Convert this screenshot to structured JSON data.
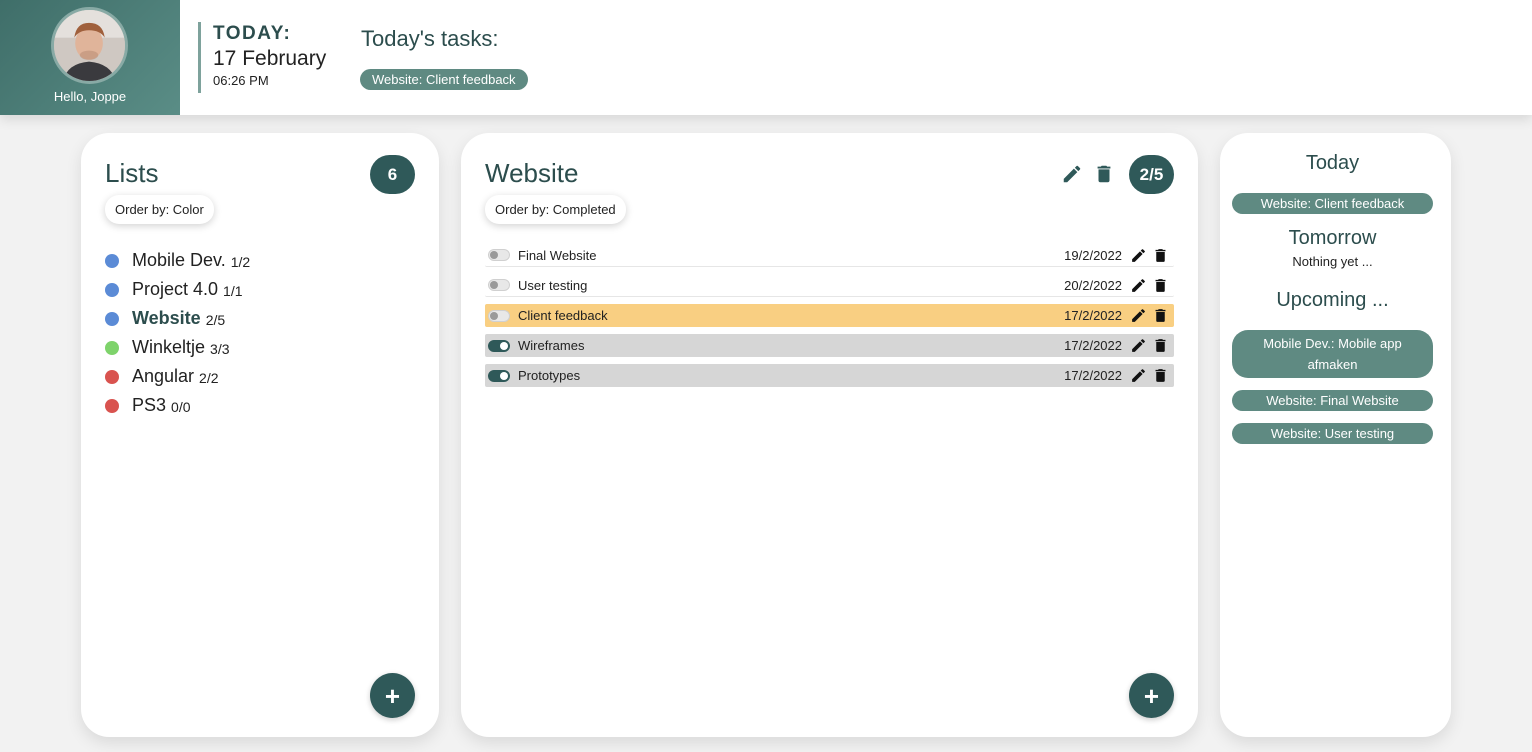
{
  "header": {
    "greeting": "Hello, Joppe",
    "today_label": "TODAY:",
    "date": "17 February",
    "time": "06:26 PM",
    "tasks_title": "Today's tasks:",
    "today_tasks": [
      "Website: Client feedback"
    ]
  },
  "lists_panel": {
    "title": "Lists",
    "count": "6",
    "order_by": "Order by: Color",
    "add_label": "+",
    "items": [
      {
        "name": "Mobile Dev.",
        "count": "1/2",
        "color": "#5b8bd6",
        "active": false
      },
      {
        "name": "Project 4.0",
        "count": "1/1",
        "color": "#5b8bd6",
        "active": false
      },
      {
        "name": "Website",
        "count": "2/5",
        "color": "#5b8bd6",
        "active": true
      },
      {
        "name": "Winkeltje",
        "count": "3/3",
        "color": "#7ed36b",
        "active": false
      },
      {
        "name": "Angular",
        "count": "2/2",
        "color": "#d9534f",
        "active": false
      },
      {
        "name": "PS3",
        "count": "0/0",
        "color": "#d9534f",
        "active": false
      }
    ]
  },
  "tasks_panel": {
    "title": "Website",
    "progress": "2/5",
    "order_by": "Order by: Completed",
    "add_label": "+",
    "tasks": [
      {
        "name": "Final Website",
        "date": "19/2/2022",
        "completed": false,
        "state": "plain"
      },
      {
        "name": "User testing",
        "date": "20/2/2022",
        "completed": false,
        "state": "plain"
      },
      {
        "name": "Client feedback",
        "date": "17/2/2022",
        "completed": false,
        "state": "today"
      },
      {
        "name": "Wireframes",
        "date": "17/2/2022",
        "completed": true,
        "state": "done"
      },
      {
        "name": "Prototypes",
        "date": "17/2/2022",
        "completed": true,
        "state": "done"
      }
    ]
  },
  "side_panel": {
    "today_heading": "Today",
    "today_items": [
      "Website: Client feedback"
    ],
    "tomorrow_heading": "Tomorrow",
    "tomorrow_empty": "Nothing yet ...",
    "upcoming_heading": "Upcoming ...",
    "upcoming_items": [
      "Mobile Dev.: Mobile app afmaken",
      "Website: Final Website",
      "Website: User testing"
    ]
  },
  "colors": {
    "accent": "#2f5959",
    "pill": "#5f8a82",
    "today_highlight": "#f9cf82",
    "completed_row": "#d6d6d6"
  },
  "icons": {
    "edit": "pencil-icon",
    "delete": "trash-icon",
    "add": "plus-icon"
  }
}
